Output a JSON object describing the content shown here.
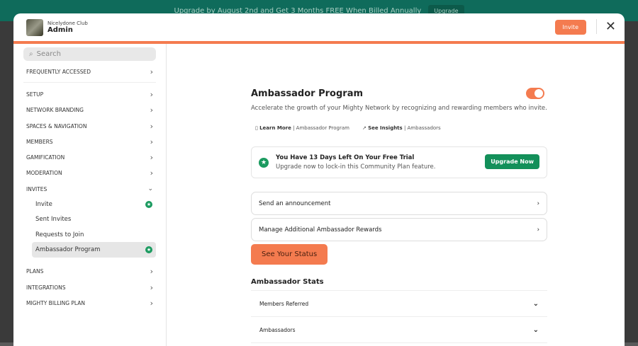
{
  "banner": {
    "text": "Upgrade by August 2nd and Get 3 Months FREE When Billed Annually",
    "button": "Upgrade"
  },
  "header": {
    "network": "Nicelydone Club",
    "title": "Admin",
    "invite": "Invite"
  },
  "sidebar": {
    "search_placeholder": "Search",
    "frequent": "FREQUENTLY ACCESSED",
    "sections": [
      "SETUP",
      "NETWORK BRANDING",
      "SPACES & NAVIGATION",
      "MEMBERS",
      "GAMIFICATION",
      "MODERATION"
    ],
    "invites": "INVITES",
    "invite_items": [
      "Invite",
      "Sent Invites",
      "Requests to Join",
      "Ambassador Program"
    ],
    "after": [
      "PLANS",
      "INTEGRATIONS",
      "MIGHTY BILLING PLAN"
    ]
  },
  "main": {
    "title": "Ambassador Program",
    "toggle_on": true,
    "description": "Accelerate the growth of your Mighty Network by recognizing and rewarding members who invite.",
    "learn_more": "Learn More",
    "learn_more_target": "| Ambassador Program",
    "insights": "See Insights",
    "insights_target": "| Ambassadors",
    "trial_title": "You Have 13 Days Left On Your Free Trial",
    "trial_sub": "Upgrade now to lock-in this Community Plan feature.",
    "upgrade_now": "Upgrade Now",
    "rows": [
      "Send an announcement",
      "Manage Additional Ambassador Rewards"
    ],
    "status_button": "See Your Status",
    "stats_title": "Ambassador Stats",
    "stats": [
      "Members Referred",
      "Ambassadors"
    ]
  }
}
